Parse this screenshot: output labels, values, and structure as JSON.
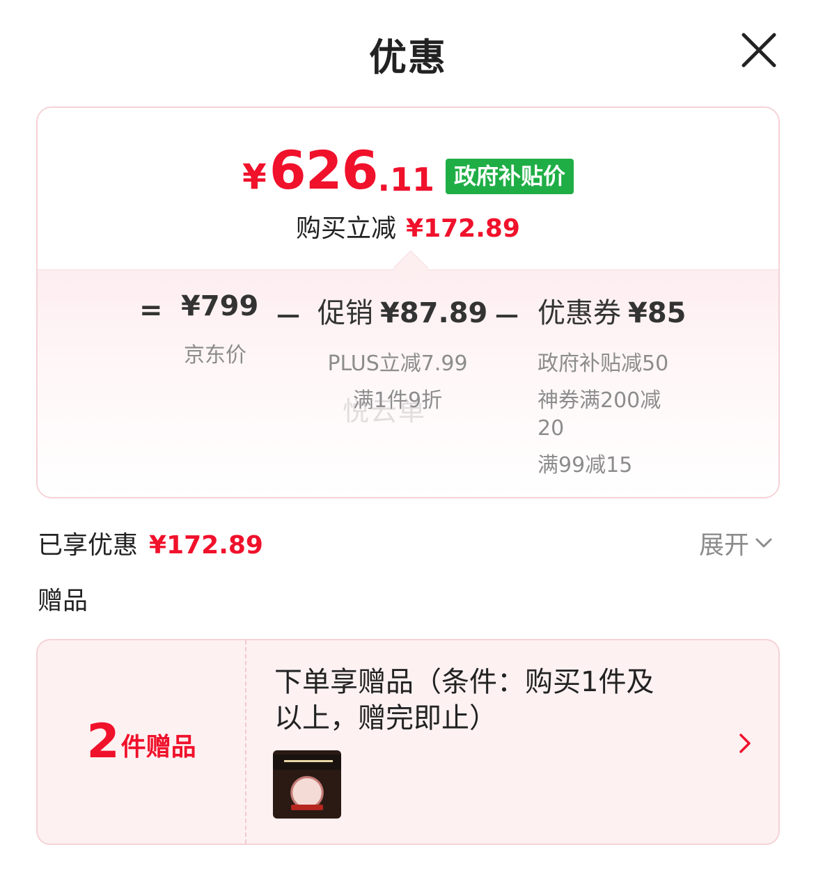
{
  "sheet": {
    "title": "优惠",
    "close_icon": "close-icon"
  },
  "summary": {
    "currency": "¥",
    "price_int": "626",
    "price_dec": ".11",
    "tag": "政府补贴价",
    "saved_label": "购买立减",
    "saved_amount": "¥172.89"
  },
  "breakdown": {
    "equals": "=",
    "minus": "－",
    "jd_price": {
      "value": "¥799",
      "label": "京东价"
    },
    "promotion": {
      "label": "促销",
      "value": "¥87.89",
      "details": [
        "PLUS立减7.99",
        "满1件9折"
      ]
    },
    "coupon": {
      "label": "优惠券",
      "value": "¥85",
      "details": [
        "政府补贴减50",
        "神券满200减",
        "20",
        "满99减15"
      ]
    }
  },
  "watermark": "悦云单",
  "enjoyed": {
    "label": "已享优惠",
    "amount": "¥172.89",
    "expand_label": "展开"
  },
  "gifts": {
    "section_label": "赠品",
    "count": "2",
    "count_suffix": "件赠品",
    "desc_line1": "下单享赠品（条件：购买1件及",
    "desc_line2": "以上，赠完即止）"
  },
  "colors": {
    "accent_red": "#f0112b",
    "gov_green": "#1fae46",
    "muted_gray": "#8c8c8c",
    "border_pink": "#f6d2d6"
  }
}
